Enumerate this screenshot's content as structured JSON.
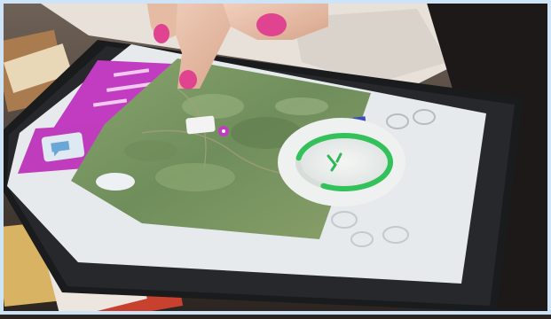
{
  "scene": {
    "description_kind": "photo",
    "colors": {
      "accent_magenta": "#c13cc0",
      "progress_green": "#33c25a",
      "map_green": "#7f9b63",
      "tablet_body": "#1b1c1e",
      "screen_white": "#e8ecee",
      "frame_blue": "#cfe3f6"
    }
  },
  "tablet": {
    "panel_lines": [
      "",
      "",
      ""
    ],
    "brand": "",
    "icons": [
      "map-pin-icon",
      "play-icon",
      "chat-icon",
      "settings-icon"
    ]
  },
  "progress": {
    "level": 0.8
  }
}
